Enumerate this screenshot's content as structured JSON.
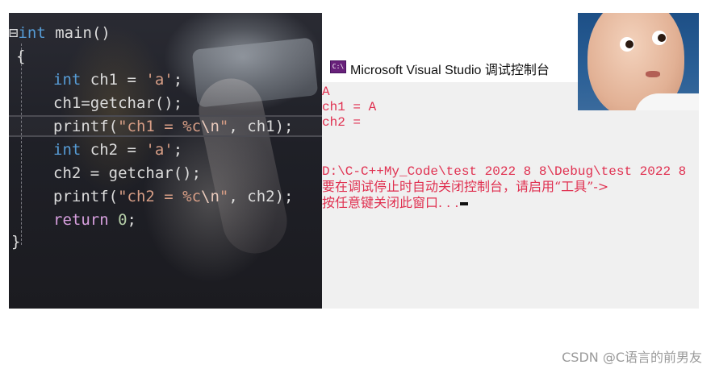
{
  "editor": {
    "code_lines": [
      {
        "parts": [
          [
            "kw",
            "int"
          ],
          [
            "brace",
            " main()"
          ]
        ]
      },
      {
        "parts": [
          [
            "brace",
            "{"
          ]
        ]
      },
      {
        "parts": [
          [
            "kw",
            "int"
          ],
          [
            "brace",
            " ch1 = "
          ],
          [
            "str",
            "'a'"
          ],
          [
            "brace",
            ";"
          ]
        ]
      },
      {
        "parts": [
          [
            "brace",
            "ch1=getchar();"
          ]
        ]
      },
      {
        "parts": [
          [
            "brace",
            "printf("
          ],
          [
            "str",
            "\"ch1 = %c"
          ],
          [
            "esc",
            "\\n"
          ],
          [
            "str",
            "\""
          ],
          [
            "brace",
            ", ch1);"
          ]
        ]
      },
      {
        "parts": [
          [
            "kw",
            "int"
          ],
          [
            "brace",
            " ch2 = "
          ],
          [
            "str",
            "'a'"
          ],
          [
            "brace",
            ";"
          ]
        ]
      },
      {
        "parts": [
          [
            "brace",
            "ch2 = getchar();"
          ]
        ]
      },
      {
        "parts": [
          [
            "brace",
            "printf("
          ],
          [
            "str",
            "\"ch2 = %c"
          ],
          [
            "esc",
            "\\n"
          ],
          [
            "str",
            "\""
          ],
          [
            "brace",
            ", ch2);"
          ]
        ]
      },
      {
        "parts": [
          [
            "kw2",
            "return"
          ],
          [
            "brace",
            " "
          ],
          [
            "num",
            "0"
          ],
          [
            "brace",
            ";"
          ]
        ]
      },
      {
        "parts": [
          [
            "brace",
            "}"
          ]
        ]
      }
    ]
  },
  "console": {
    "title": "Microsoft Visual Studio 调试控制台",
    "icon_label": "C:\\",
    "output": [
      "A",
      "ch1 = A",
      "ch2 =",
      "",
      "",
      "D:\\C-C++My_Code\\test 2022 8 8\\Debug\\test 2022 8",
      "要在调试停止时自动关闭控制台，请启用“工具”->",
      "按任意键关闭此窗口. . ."
    ]
  },
  "watermark": "CSDN @C语言的前男友"
}
